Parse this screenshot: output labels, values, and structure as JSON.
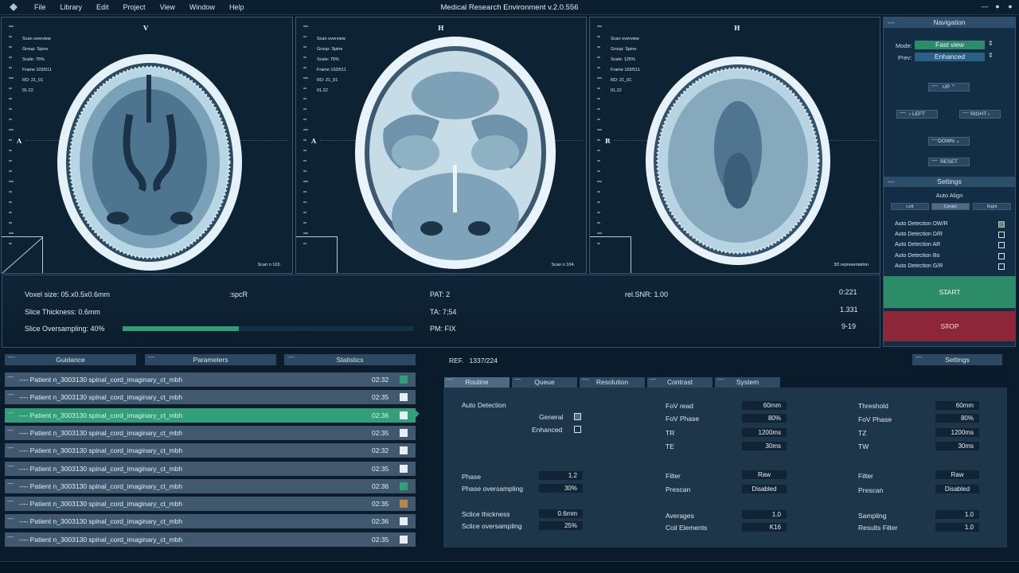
{
  "app": {
    "title": "Medical Research Environment v.2.0.556",
    "menu": [
      "File",
      "Library",
      "Edit",
      "Project",
      "View",
      "Window",
      "Help"
    ],
    "window_controls": [
      "—",
      "●",
      "●"
    ]
  },
  "viewports": [
    {
      "orient_top": "V",
      "orient_left": "A",
      "info": [
        "Scan overview",
        "Group: Spine",
        "Scale: 75%",
        "Frame 103/511",
        "RD: 21_01",
        "01.22"
      ],
      "label": "Scan n 103."
    },
    {
      "orient_top": "H",
      "orient_left": "A",
      "info": [
        "Scan overview",
        "Group: Spine",
        "Scale: 75%",
        "Frame 103/511",
        "RD: 21_01",
        "01.22"
      ],
      "label": "Scan n 104."
    },
    {
      "orient_top": "H",
      "orient_left": "R",
      "info": [
        "Scan overview",
        "Group: Spine",
        "Scale: 125%",
        "Frame 103/511",
        "RD: 21_01",
        "01.22"
      ],
      "label": "3D representation"
    }
  ],
  "navigation": {
    "header": "Navigation",
    "mode_label": "Mode:",
    "mode_value": "Fast view",
    "prev_label": "Prev:",
    "prev_value": "Enhanced",
    "up": "UP",
    "left": "LEFT",
    "right": "RIGHT",
    "down": "DOWN",
    "reset": "RESET"
  },
  "settings": {
    "header": "Settings",
    "auto_align": "Auto Align",
    "align_options": [
      "Left",
      "Center",
      "Right"
    ],
    "detections": [
      {
        "label": "Auto Detection DW/R",
        "checked": true
      },
      {
        "label": "Auto Detection D/R",
        "checked": false
      },
      {
        "label": "Auto Detection AR",
        "checked": false
      },
      {
        "label": "Auto Detection Bo",
        "checked": false
      },
      {
        "label": "Auto Detection G/R",
        "checked": false
      }
    ]
  },
  "actions": {
    "start": "START",
    "stop": "STOP"
  },
  "info": {
    "voxel": "Voxel size: 05.x0.5x0.6mm",
    "spcr": ":spcR",
    "pat": "PAT: 2",
    "rel_snr": "rel.SNR: 1.00",
    "v1": "0:221",
    "thickness": "Slice Thickness: 0.6mm",
    "ta": "TA: 7;54",
    "v2": "1.331",
    "oversampling": "Slice Oversampling: 40%",
    "oversampling_percent": 40,
    "pm": "PM: FIX",
    "v3": "9-19"
  },
  "panel_tabs": [
    "Guidance",
    "Parameters",
    "Statistics"
  ],
  "ref": {
    "label": "REF.",
    "value": "1337/224"
  },
  "settings_tab": "Settings",
  "patients": [
    {
      "name": "---- Patient n_3003130 spinal_cord_imaginary_ct_mbh",
      "time": "02:32",
      "color": "#2fa077",
      "active": false
    },
    {
      "name": "---- Patient n_3003130 spinal_cord_imaginary_ct_mbh",
      "time": "02:35",
      "color": "#e7eef3",
      "active": false
    },
    {
      "name": "---- Patient n_3003130 spinal_cord_imaginary_ct_mbh",
      "time": "02:36",
      "color": "#e7eef3",
      "active": true
    },
    {
      "name": "---- Patient n_3003130 spinal_cord_imaginary_ct_mbh",
      "time": "02:35",
      "color": "#e7eef3",
      "active": false
    },
    {
      "name": "---- Patient n_3003130 spinal_cord_imaginary_ct_mbh",
      "time": "02:32",
      "color": "#e7eef3",
      "active": false
    },
    {
      "name": "---- Patient n_3003130 spinal_cord_imaginary_ct_mbh",
      "time": "02:35",
      "color": "#e7eef3",
      "active": false
    },
    {
      "name": "---- Patient n_3003130 spinal_cord_imaginary_ct_mbh",
      "time": "02:36",
      "color": "#2fa077",
      "active": false
    },
    {
      "name": "---- Patient n_3003130 spinal_cord_imaginary_ct_mbh",
      "time": "02:35",
      "color": "#b8874a",
      "active": false
    },
    {
      "name": "---- Patient n_3003130 spinal_cord_imaginary_ct_mbh",
      "time": "02:36",
      "color": "#e7eef3",
      "active": false
    },
    {
      "name": "---- Patient n_3003130 spinal_cord_imaginary_ct_mbh",
      "time": "02:35",
      "color": "#e7eef3",
      "active": false
    }
  ],
  "param_tabs": [
    "Routine",
    "Queue",
    "Resolution",
    "Contrast",
    "System"
  ],
  "routine": {
    "auto_detection": "Auto Detection",
    "general": "General",
    "enhanced": "Enhanced",
    "phase": "Phase",
    "phase_value": "1.2",
    "phase_os": "Phase oversampling",
    "phase_os_value": "30%",
    "slice_thickness": "Sclice thickness",
    "slice_thickness_value": "0.6mm",
    "slice_os": "Sclice oversampling",
    "slice_os_value": "25%",
    "fov_read": "FoV read",
    "fov_read_value": "60mm",
    "fov_phase": "FoV Phase",
    "fov_phase_value": "80%",
    "tr": "TR",
    "tr_value": "1200ms",
    "te": "TE",
    "te_value": "30ms",
    "filter": "Filter",
    "filter_value": "Raw",
    "prescan": "Prescan",
    "prescan_value": "Disabled",
    "averages": "Averages",
    "averages_value": "1.0",
    "coil": "Coil Elements",
    "coil_value": "K16",
    "threshold": "Threshold",
    "threshold_value": "60mm",
    "fov_phase2": "FoV Phase",
    "fov_phase2_value": "80%",
    "tz": "TZ",
    "tz_value": "1200ms",
    "tw": "TW",
    "tw_value": "30ms",
    "filter2": "Filter",
    "filter2_value": "Raw",
    "prescan2": "Prescan",
    "prescan2_value": "Disabled",
    "sampling": "Sampling",
    "sampling_value": "1.0",
    "results_filter": "Results Filter",
    "results_filter_value": "1.0"
  }
}
